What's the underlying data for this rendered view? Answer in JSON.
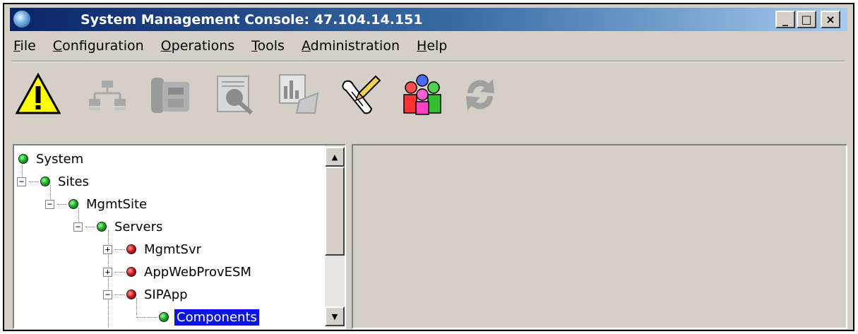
{
  "window": {
    "title": "System Management Console: 47.104.14.151",
    "controls": {
      "minimize": "_",
      "maximize": "□",
      "close": "×"
    }
  },
  "menubar": {
    "items": [
      {
        "mnemonic": "F",
        "rest": "ile"
      },
      {
        "mnemonic": "C",
        "rest": "onfiguration"
      },
      {
        "mnemonic": "O",
        "rest": "perations"
      },
      {
        "mnemonic": "T",
        "rest": "ools"
      },
      {
        "mnemonic": "A",
        "rest": "dministration"
      },
      {
        "mnemonic": "H",
        "rest": "elp"
      }
    ]
  },
  "toolbar": {
    "buttons": [
      {
        "icon": "alarm-warning-icon",
        "enabled": true
      },
      {
        "icon": "topology-icon",
        "enabled": false
      },
      {
        "icon": "telephone-icon",
        "enabled": false
      },
      {
        "icon": "search-report-icon",
        "enabled": false
      },
      {
        "icon": "chart-report-icon",
        "enabled": false
      },
      {
        "icon": "script-edit-icon",
        "enabled": true
      },
      {
        "icon": "users-group-icon",
        "enabled": true
      },
      {
        "icon": "refresh-icon",
        "enabled": false
      }
    ]
  },
  "tree": {
    "nodes": [
      {
        "label": "System",
        "status": "green",
        "expander": ""
      },
      {
        "label": "Sites",
        "status": "green",
        "expander": "−"
      },
      {
        "label": "MgmtSite",
        "status": "green",
        "expander": "−"
      },
      {
        "label": "Servers",
        "status": "green",
        "expander": "−"
      },
      {
        "label": "MgmtSvr",
        "status": "red",
        "expander": "+"
      },
      {
        "label": "AppWebProvESM",
        "status": "red",
        "expander": "+"
      },
      {
        "label": "SIPApp",
        "status": "red",
        "expander": "−"
      },
      {
        "label": "Components",
        "status": "green",
        "expander": "",
        "selected": true
      }
    ],
    "scroll": {
      "up": "▲",
      "down": "▼"
    }
  },
  "colors": {
    "title_start": "#0a246a",
    "title_end": "#a6caf0",
    "selection": "#0a14e6",
    "status_green": "#14a81e",
    "status_red": "#d11212"
  }
}
